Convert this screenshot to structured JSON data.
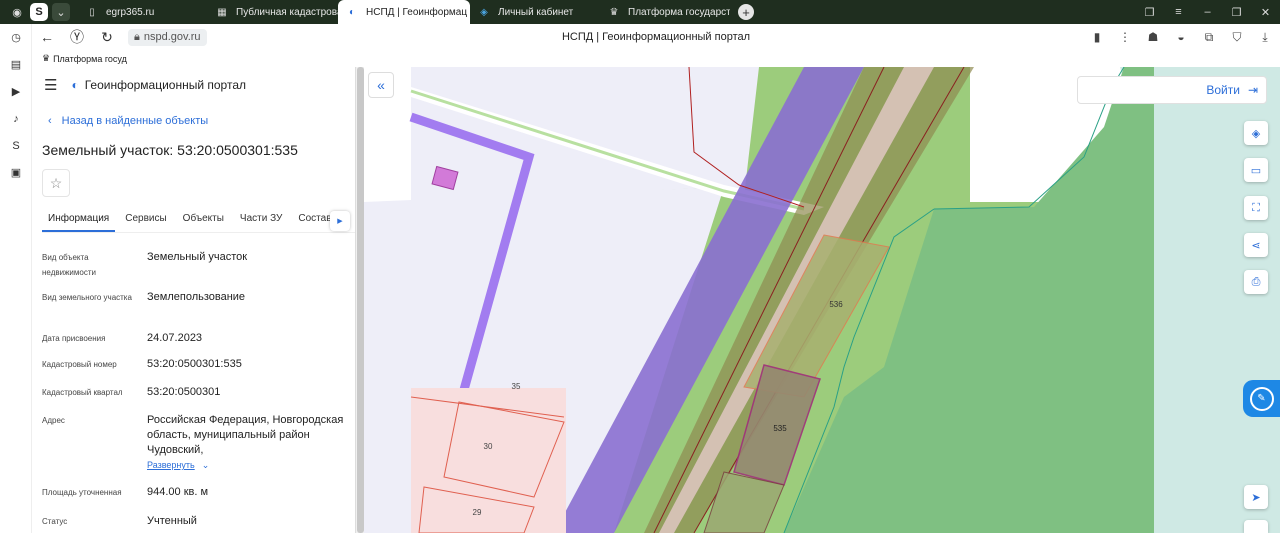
{
  "browser": {
    "tabs": [
      {
        "label": "egrp365.ru",
        "favicon": "document-icon",
        "active": false
      },
      {
        "label": "Публичная кадастровая",
        "favicon": "map-icon",
        "active": false
      },
      {
        "label": "НСПД | Геоинформац",
        "favicon": "nspd-logo-icon",
        "active": true
      },
      {
        "label": "Личный кабинет",
        "favicon": "shield-icon",
        "active": false
      },
      {
        "label": "Платформа государстве",
        "favicon": "emblem-icon",
        "active": false
      }
    ],
    "url": "nspd.gov.ru",
    "page_title": "НСПД | Геоинформационный портал",
    "bookmark": "Платформа госуд"
  },
  "panel": {
    "brand": "Геоинформационный портал",
    "back_link": "Назад в найденные объекты",
    "title": "Земельный участок: 53:20:0500301:535",
    "tabs": [
      "Информация",
      "Сервисы",
      "Объекты",
      "Части ЗУ",
      "Состав"
    ],
    "properties": [
      {
        "label": "Вид объекта недвижимости",
        "value": "Земельный участок"
      },
      {
        "label": "Вид земельного участка",
        "value": "Землепользование"
      },
      {
        "label": "Дата присвоения",
        "value": "24.07.2023"
      },
      {
        "label": "Кадастровый номер",
        "value": "53:20:0500301:535"
      },
      {
        "label": "Кадастровый квартал",
        "value": "53:20:0500301"
      },
      {
        "label": "Адрес",
        "value": "Российская Федерация, Новгородская область, муниципальный район Чудовский,"
      },
      {
        "label": "Площадь уточненная",
        "value": "944.00 кв. м"
      },
      {
        "label": "Статус",
        "value": "Учтенный"
      }
    ],
    "expand_label": "Развернуть"
  },
  "map": {
    "login_label": "Войти",
    "parcel_labels": [
      "536",
      "535",
      "30",
      "29",
      "35"
    ],
    "colors": {
      "green_light": "#9ccc7c",
      "green_dark": "#7fc082",
      "teal": "#cfe9e4",
      "purple": "#8a6fd0",
      "violet_line": "#a27cf0",
      "parcel_pink": "#f8dede",
      "highlight": "#a0608a"
    }
  }
}
